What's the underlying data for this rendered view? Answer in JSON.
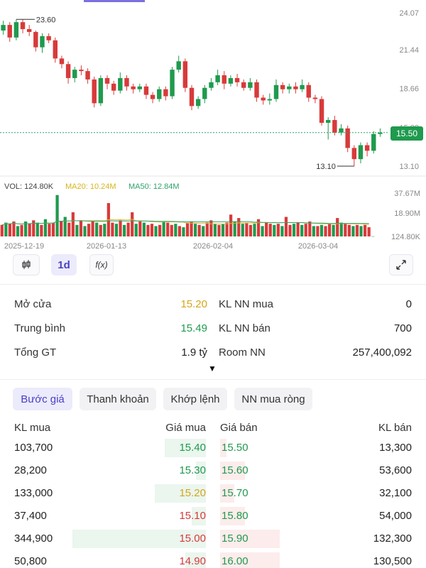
{
  "colors": {
    "up": "#1f9a4e",
    "down": "#d83a3a",
    "ref": "#d6a51a",
    "accent": "#4a3fc4"
  },
  "chart_data": [
    {
      "type": "candlestick",
      "y_ticks": [
        "24.07",
        "21.44",
        "18.66",
        "15.88",
        "13.10"
      ],
      "ylim": [
        13.1,
        24.07
      ],
      "current_price": "15.50",
      "high_label": "23.60",
      "low_label": "13.10",
      "candles": [
        [
          22.8,
          23.2,
          23.5,
          22.5
        ],
        [
          23.2,
          22.3,
          23.4,
          22.0
        ],
        [
          22.3,
          23.4,
          23.6,
          22.1
        ],
        [
          23.4,
          22.9,
          23.6,
          22.6
        ],
        [
          22.9,
          22.7,
          23.2,
          22.4
        ],
        [
          22.7,
          21.6,
          22.8,
          21.3
        ],
        [
          21.6,
          22.4,
          22.6,
          21.2
        ],
        [
          22.4,
          22.1,
          22.6,
          21.9
        ],
        [
          22.1,
          20.8,
          22.3,
          20.5
        ],
        [
          20.8,
          20.4,
          21.0,
          20.1
        ],
        [
          20.4,
          19.4,
          20.6,
          19.0
        ],
        [
          19.4,
          20.0,
          20.2,
          19.1
        ],
        [
          20.0,
          19.9,
          20.3,
          19.6
        ],
        [
          19.9,
          19.3,
          20.1,
          19.0
        ],
        [
          19.3,
          17.6,
          19.5,
          17.3
        ],
        [
          17.6,
          19.4,
          19.6,
          17.4
        ],
        [
          19.4,
          19.0,
          19.6,
          18.6
        ],
        [
          19.0,
          18.5,
          19.2,
          18.2
        ],
        [
          18.5,
          19.4,
          19.8,
          18.3
        ],
        [
          19.4,
          18.8,
          19.6,
          18.5
        ],
        [
          18.8,
          18.6,
          19.0,
          18.3
        ],
        [
          18.6,
          18.8,
          19.0,
          18.4
        ],
        [
          18.8,
          18.2,
          19.0,
          17.9
        ],
        [
          18.2,
          17.9,
          18.4,
          17.6
        ],
        [
          17.9,
          18.6,
          18.8,
          17.7
        ],
        [
          18.6,
          18.1,
          18.8,
          17.8
        ],
        [
          18.1,
          20.0,
          20.2,
          17.9
        ],
        [
          20.0,
          20.6,
          21.0,
          19.8
        ],
        [
          20.6,
          18.7,
          20.8,
          18.4
        ],
        [
          18.7,
          17.4,
          18.9,
          17.1
        ],
        [
          17.4,
          17.9,
          18.1,
          17.2
        ],
        [
          17.9,
          18.7,
          18.9,
          17.6
        ],
        [
          18.7,
          19.1,
          19.4,
          18.5
        ],
        [
          19.1,
          19.6,
          20.0,
          18.9
        ],
        [
          19.6,
          19.0,
          19.9,
          18.6
        ],
        [
          19.0,
          19.4,
          19.6,
          18.8
        ],
        [
          19.4,
          19.1,
          19.7,
          18.8
        ],
        [
          19.1,
          18.7,
          19.3,
          18.5
        ],
        [
          18.7,
          19.1,
          19.4,
          18.5
        ],
        [
          19.1,
          18.0,
          19.3,
          17.7
        ],
        [
          18.0,
          17.8,
          18.2,
          17.5
        ],
        [
          17.8,
          17.9,
          18.3,
          17.5
        ],
        [
          17.9,
          18.9,
          19.3,
          17.7
        ],
        [
          18.9,
          18.6,
          19.1,
          18.3
        ],
        [
          18.6,
          18.8,
          19.0,
          18.3
        ],
        [
          18.8,
          18.6,
          19.1,
          18.3
        ],
        [
          18.6,
          18.9,
          19.3,
          18.4
        ],
        [
          18.9,
          18.0,
          19.1,
          17.7
        ],
        [
          18.0,
          17.9,
          18.2,
          17.6
        ],
        [
          17.9,
          16.2,
          18.1,
          16.0
        ],
        [
          16.2,
          16.4,
          16.6,
          15.0
        ],
        [
          16.4,
          15.5,
          16.7,
          15.3
        ],
        [
          15.5,
          15.8,
          16.1,
          15.3
        ],
        [
          15.8,
          14.4,
          16.0,
          14.1
        ],
        [
          14.4,
          13.6,
          14.6,
          13.1
        ],
        [
          13.6,
          14.6,
          14.8,
          13.3
        ],
        [
          14.6,
          14.2,
          14.8,
          13.8
        ],
        [
          14.2,
          15.4,
          15.6,
          14.0
        ],
        [
          15.4,
          15.5,
          15.8,
          15.2
        ]
      ],
      "x_labels": [
        "2025-12-19",
        "2026-01-13",
        "2026-02-04",
        "2026-03-04"
      ]
    },
    {
      "type": "bar",
      "legend": {
        "vol": "VOL: 124.80K",
        "ma20": "MA20: 10.24M",
        "ma50": "MA50: 12.84M"
      },
      "y_ticks": [
        "37.67M",
        "18.90M",
        "124.80K"
      ],
      "ylim": [
        0,
        37.67
      ],
      "volumes": [
        10,
        12,
        11,
        13,
        9,
        10,
        13,
        11,
        14,
        12,
        10,
        15,
        11,
        12,
        36,
        13,
        17,
        12,
        21,
        10,
        14,
        9,
        11,
        13,
        12,
        10,
        11,
        29,
        12,
        11,
        14,
        10,
        12,
        21,
        11,
        13,
        12,
        10,
        11,
        9,
        10,
        13,
        12,
        10,
        11,
        9,
        8,
        12,
        13,
        11,
        10,
        9,
        12,
        14,
        11,
        10,
        11,
        12,
        19,
        13,
        16,
        11,
        12,
        10,
        11,
        15,
        9,
        12,
        11,
        10,
        11,
        9,
        17,
        10,
        11,
        12,
        10,
        11,
        13,
        9,
        9,
        10,
        9,
        11,
        10,
        16,
        12,
        11,
        10,
        9,
        10,
        9,
        10,
        8,
        0.12
      ]
    }
  ],
  "toolbar": {
    "chart_type_icon": "candlestick-icon",
    "interval": "1d",
    "indicator_label": "f(x)",
    "fullscreen_icon": "expand-arrows-icon"
  },
  "stats": {
    "open_label": "Mở cửa",
    "open_value": "15.20",
    "avg_label": "Trung bình",
    "avg_value": "15.49",
    "total_label": "Tổng GT",
    "total_value": "1.9 tỷ",
    "nn_buy_label": "KL NN mua",
    "nn_buy_value": "0",
    "nn_sell_label": "KL NN bán",
    "nn_sell_value": "700",
    "room_label": "Room NN",
    "room_value": "257,400,092",
    "expand_glyph": "▼"
  },
  "chips": [
    "Bước giá",
    "Thanh khoản",
    "Khớp lệnh",
    "NN mua ròng"
  ],
  "book": {
    "headers": [
      "KL mua",
      "Giá mua",
      "Giá bán",
      "KL bán"
    ],
    "rows": [
      {
        "buy_vol": "103,700",
        "buy_price": "15.40",
        "sell_price": "15.50",
        "sell_vol": "13,300",
        "buy_color": "green",
        "sell_color": "green",
        "buy_bar": 0.2,
        "sell_bar": 0.03
      },
      {
        "buy_vol": "28,200",
        "buy_price": "15.30",
        "sell_price": "15.60",
        "sell_vol": "53,600",
        "buy_color": "green",
        "sell_color": "green",
        "buy_bar": 0.05,
        "sell_bar": 0.12
      },
      {
        "buy_vol": "133,000",
        "buy_price": "15.20",
        "sell_price": "15.70",
        "sell_vol": "32,100",
        "buy_color": "yellow",
        "sell_color": "green",
        "buy_bar": 0.25,
        "sell_bar": 0.07
      },
      {
        "buy_vol": "37,400",
        "buy_price": "15.10",
        "sell_price": "15.80",
        "sell_vol": "54,000",
        "buy_color": "red",
        "sell_color": "green",
        "buy_bar": 0.07,
        "sell_bar": 0.12
      },
      {
        "buy_vol": "344,900",
        "buy_price": "15.00",
        "sell_price": "15.90",
        "sell_vol": "132,300",
        "buy_color": "red",
        "sell_color": "green",
        "buy_bar": 0.65,
        "sell_bar": 0.29
      },
      {
        "buy_vol": "50,800",
        "buy_price": "14.90",
        "sell_price": "16.00",
        "sell_vol": "130,500",
        "buy_color": "red",
        "sell_color": "green",
        "buy_bar": 0.1,
        "sell_bar": 0.29
      }
    ]
  }
}
